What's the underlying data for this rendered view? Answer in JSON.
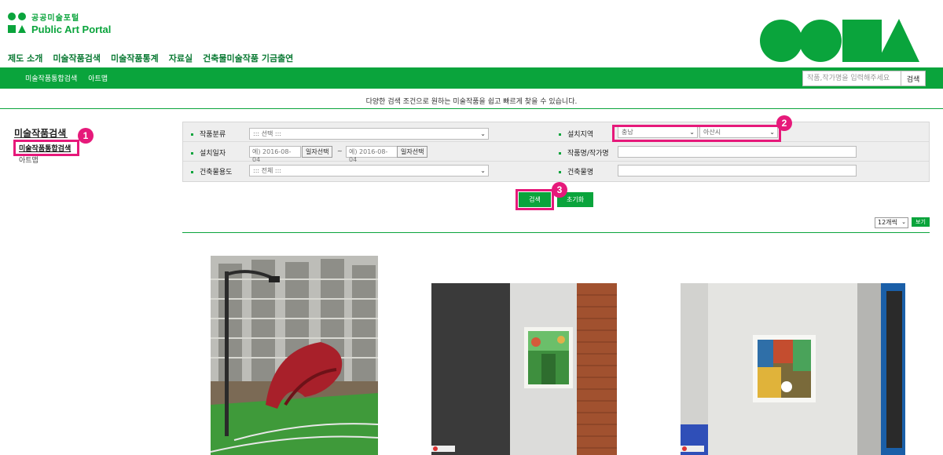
{
  "header": {
    "logo_ko": "공공미술포털",
    "logo_en": "Public Art Portal",
    "gnb": [
      "제도 소개",
      "미술작품검색",
      "미술작품통계",
      "자료실",
      "건축물미술작품 기금출연"
    ],
    "gnb_active": "미술작품검색",
    "sub_menu": [
      "미술작품통합검색",
      "아트맵"
    ],
    "search_placeholder": "작품,작가명을 입력해주세요",
    "search_button": "검색"
  },
  "intro_text": "다양한 검색 조건으로 원하는 미술작품을 쉽고 빠르게 찾을 수 있습니다.",
  "sidebar": {
    "title": "미술작품검색",
    "items": [
      "미술작품통합검색",
      "아트맵"
    ]
  },
  "form": {
    "category_label": "작품분류",
    "category_value": "::: 선택 :::",
    "region_label": "설치지역",
    "region_value": "충남",
    "city_value": "아산시",
    "date_label": "설치일자",
    "date_from": "예) 2016-08-04",
    "date_to": "예) 2016-08-04",
    "date_button": "일자선택",
    "tilde": "~",
    "title_label": "작품명/작가명",
    "usage_label": "건축물용도",
    "usage_value": "::: 전체 :::",
    "building_label": "건축물명"
  },
  "buttons": {
    "search": "검색",
    "reset": "초기화",
    "per_page": "12개씩",
    "view": "보기"
  },
  "annotations": [
    "1",
    "2",
    "3"
  ],
  "colors": {
    "brand_green": "#0aa43c",
    "highlight_pink": "#e6197a"
  }
}
